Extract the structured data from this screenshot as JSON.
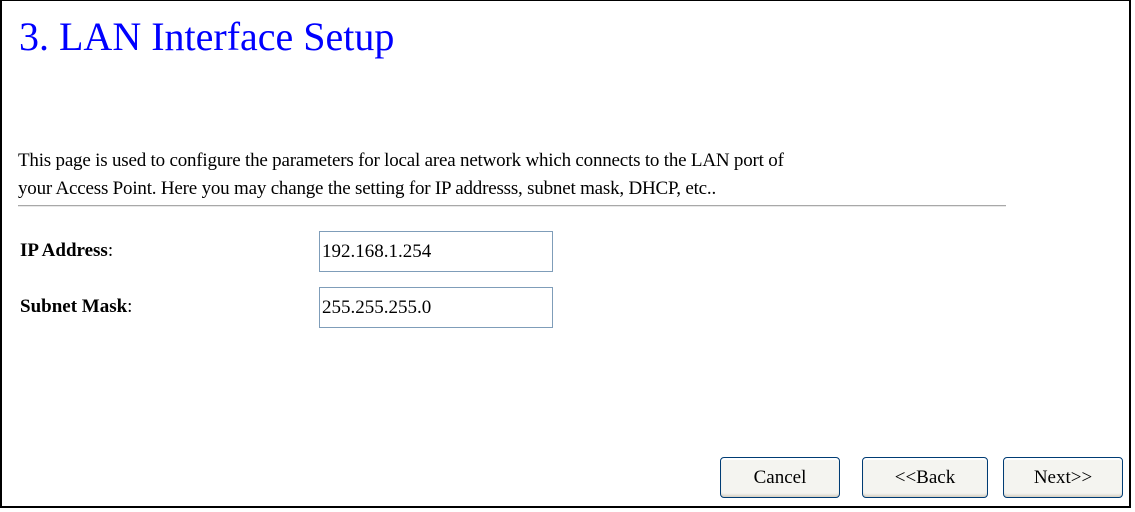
{
  "page": {
    "title": "3. LAN Interface Setup",
    "description_line1": "This page is used to configure the parameters for local area network which connects to the LAN port of",
    "description_line2": "your Access Point. Here you may change the setting for IP addresss, subnet mask, DHCP, etc.."
  },
  "form": {
    "ip_address": {
      "label": "IP Address",
      "colon": ":",
      "value": "192.168.1.254"
    },
    "subnet_mask": {
      "label": "Subnet Mask",
      "colon": ":",
      "value": "255.255.255.0"
    }
  },
  "buttons": {
    "cancel_label": "Cancel",
    "back_label": "<<Back",
    "next_label": "Next>>"
  },
  "colors": {
    "title": "#0000ff",
    "input_border": "#7f9db9",
    "button_border": "#003c74"
  }
}
